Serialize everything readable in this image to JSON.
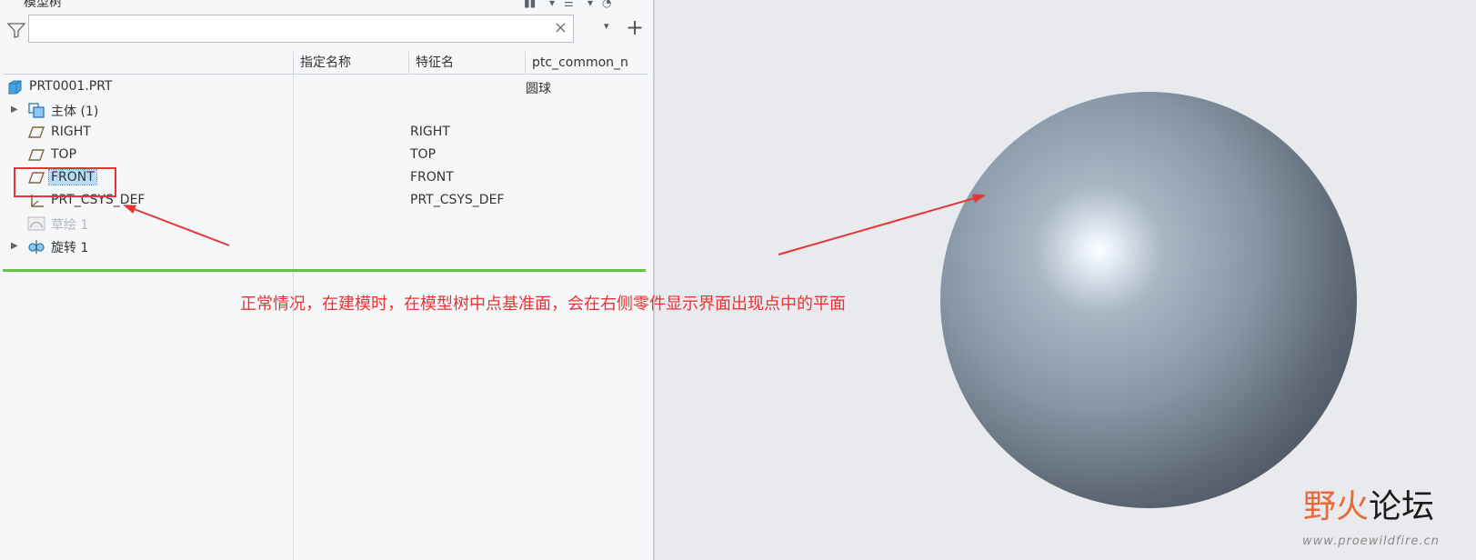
{
  "panel": {
    "title": "模型树",
    "search": {
      "value": "",
      "placeholder": "",
      "clear_glyph": "×"
    },
    "dropdown_glyph": "▾",
    "add_glyph": "+"
  },
  "columns": [
    "指定名称",
    "特征名",
    "ptc_common_n"
  ],
  "tree": {
    "root": {
      "label": "PRT0001.PRT",
      "common": "圆球"
    },
    "items": [
      {
        "label": "主体 (1)",
        "feature": "",
        "icon": "body-icon"
      },
      {
        "label": "RIGHT",
        "feature": "RIGHT",
        "icon": "datum-plane-icon"
      },
      {
        "label": "TOP",
        "feature": "TOP",
        "icon": "datum-plane-icon"
      },
      {
        "label": "FRONT",
        "feature": "FRONT",
        "icon": "datum-plane-icon"
      },
      {
        "label": "PRT_CSYS_DEF",
        "feature": "PRT_CSYS_DEF",
        "icon": "coordinate-system-icon"
      },
      {
        "label": "草绘 1",
        "feature": "",
        "icon": "sketch-icon"
      },
      {
        "label": "旋转 1",
        "feature": "",
        "icon": "revolve-icon"
      }
    ]
  },
  "annotation": "正常情况，在建模时，在模型树中点基准面，会在右侧零件显示界面出现点中的平面",
  "watermark": {
    "part1": "野火",
    "part2": "论坛",
    "url": "www.proewildfire.cn"
  },
  "colors": {
    "annotation": "#e83434",
    "selection": "#b9dcf4",
    "insert_line": "#6cbf4a"
  }
}
